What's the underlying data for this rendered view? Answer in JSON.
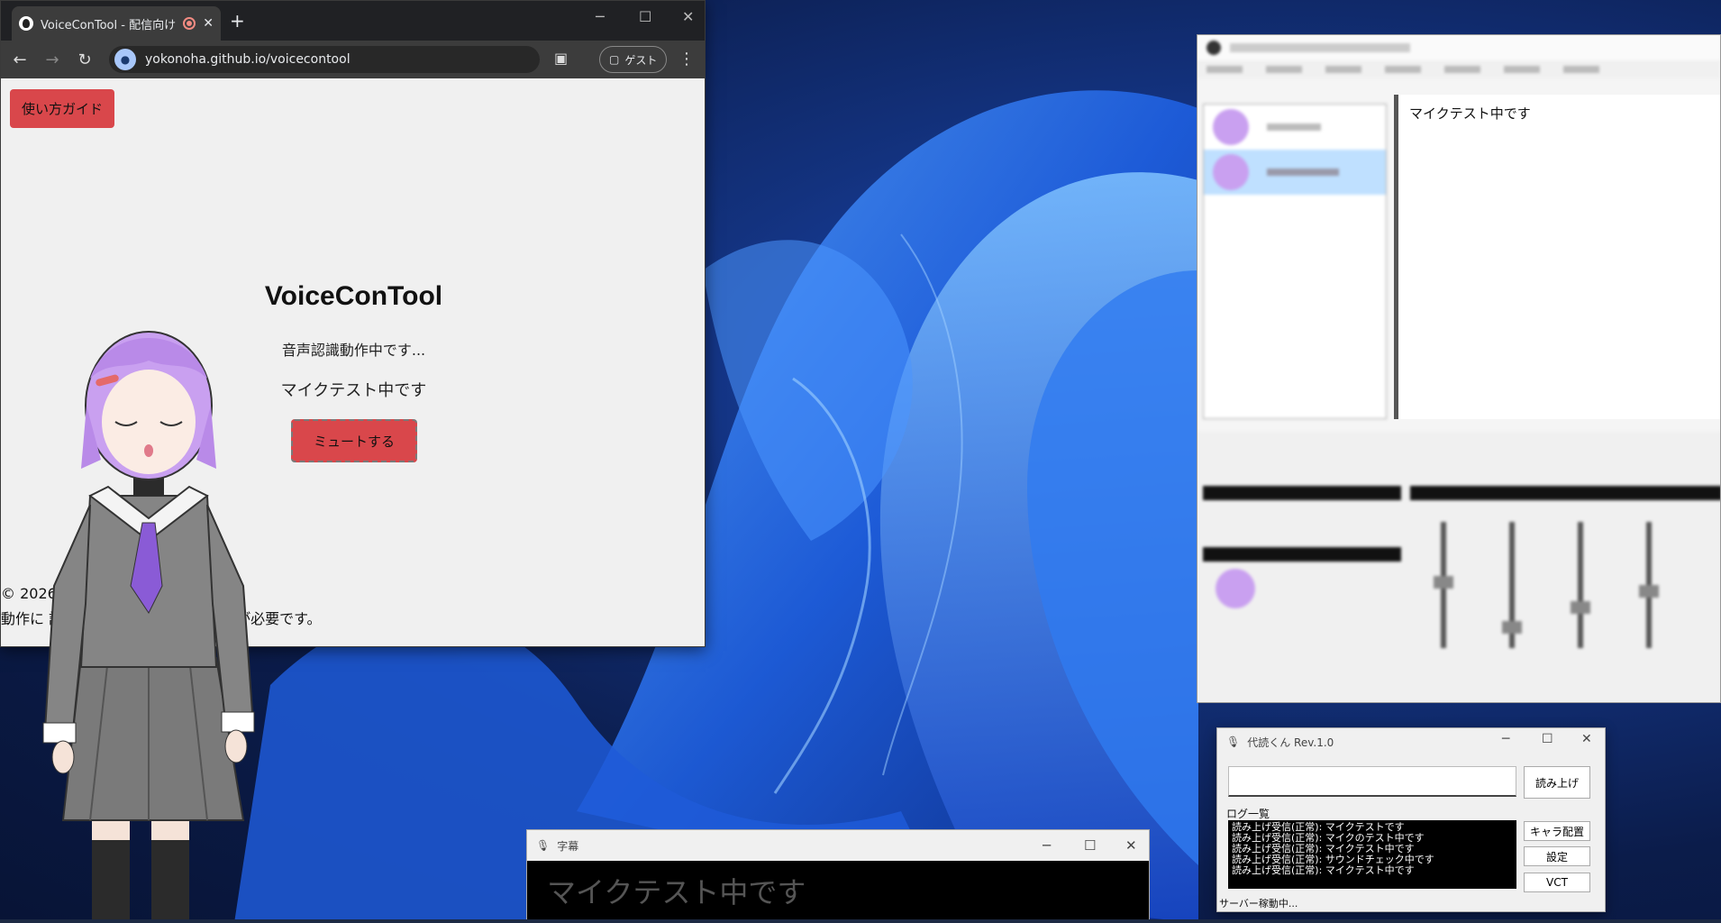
{
  "browser": {
    "tab_title": "VoiceConTool - 配信向け音",
    "tab_close": "✕",
    "new_tab": "+",
    "url": "yokonoha.github.io/voicecontool",
    "profile_label": "ゲスト",
    "minimize": "─",
    "maximize": "☐",
    "close": "✕"
  },
  "page": {
    "guide_button": "使い方ガイド",
    "title": "VoiceConTool",
    "status": "音声認識動作中です...",
    "recognized": "マイクテスト中です",
    "mute_button": "ミュートする",
    "copyright": "© 2026                              ghts reserved.",
    "requirement": "動作に                                読くん」と有償の対応ソフトが必要です。"
  },
  "editor": {
    "text": "マイクテスト中です"
  },
  "daidoku": {
    "title": "代読くん Rev.1.0",
    "read_button": "読み上げ",
    "log_label": "ログ一覧",
    "log_lines": [
      "読み上げ受信(正常): マイクテストです",
      "読み上げ受信(正常): マイクのテスト中です",
      "読み上げ受信(正常): マイクテスト中です",
      "読み上げ受信(正常): サウンドチェック中です",
      "読み上げ受信(正常): マイクテスト中です"
    ],
    "char_button": "キャラ配置",
    "settings_button": "設定",
    "vct_button": "VCT",
    "status": "サーバー稼動中..."
  },
  "subtitle_window": {
    "title": "字幕",
    "text": "マイクテスト中です"
  }
}
